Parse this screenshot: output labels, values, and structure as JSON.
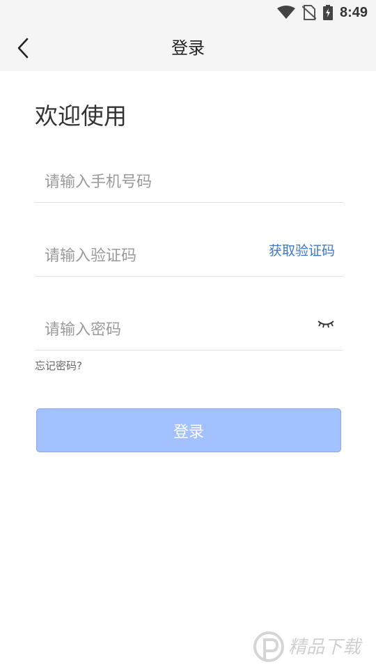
{
  "status": {
    "time": "8:49"
  },
  "app_bar": {
    "title": "登录"
  },
  "welcome": "欢迎使用",
  "form": {
    "phone_placeholder": "请输入手机号码",
    "code_placeholder": "请输入验证码",
    "get_code_label": "获取验证码",
    "password_placeholder": "请输入密码",
    "forgot_label": "忘记密码?"
  },
  "login_button": "登录",
  "watermark": "精品下载",
  "colors": {
    "accent": "#3a78c9",
    "button_bg": "#a3c0ff",
    "bar_bg": "#f5f5f5"
  },
  "icons": [
    "wifi-icon",
    "no-sim-icon",
    "battery-icon",
    "back-arrow-icon",
    "eye-closed-icon"
  ]
}
